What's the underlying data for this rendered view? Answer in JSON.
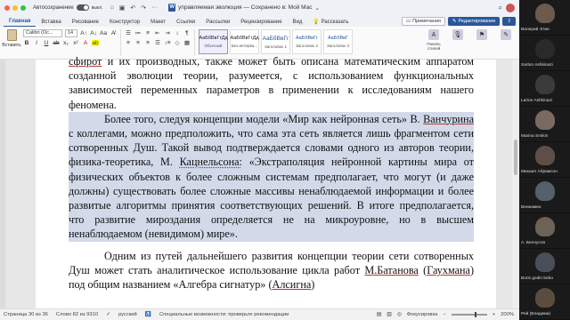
{
  "titlebar": {
    "autosave_label": "Автосохранение",
    "autosave_state": "выкл.",
    "doc_title": "управляемая эволюция — Сохранено в: Мой Мас"
  },
  "ribbon_tabs": [
    "Главная",
    "Вставка",
    "Рисование",
    "Конструктор",
    "Макет",
    "Ссылки",
    "Рассылки",
    "Рецензирование",
    "Вид",
    "Рассказать"
  ],
  "tab_buttons": {
    "comments": "Примечания",
    "edit": "Редактирование"
  },
  "ribbon": {
    "paste_label": "Вставить",
    "font_name": "Calibri (Ос...",
    "font_size": "14",
    "styles": [
      {
        "sample": "АаБбВвГгДд",
        "name": "Обычный"
      },
      {
        "sample": "АаБбВвГгДд",
        "name": "Без интерва..."
      },
      {
        "sample": "АаБбВвГг",
        "name": "Заголовок 1"
      },
      {
        "sample": "АаБбВвГг",
        "name": "Заголовок 2"
      },
      {
        "sample": "АаБбВвГ",
        "name": "Заголовок 3"
      }
    ],
    "right_buttons": [
      {
        "label": "Панель стилей",
        "icon": "styles-pane-icon"
      },
      {
        "label": "Диктовать",
        "icon": "dictate-icon"
      },
      {
        "label": "Конфиденц.",
        "icon": "sensitivity-icon"
      },
      {
        "label": "Редактор",
        "icon": "editor-icon"
      }
    ]
  },
  "document": {
    "para1": {
      "u1": "сфирот",
      "t1": " и их производных, также может быть описана математическим аппаратом созданной эволюции теории, разумеется, с использованием функциональных зависимостей переменных параметров в применении к исследованиям нашего феномена."
    },
    "para2": {
      "t1": "Более того, следуя концепции модели «Мир как нейронная сеть» В. ",
      "u1": "Ванчурина",
      "t2": " с коллегами, можно предположить, что сама эта сеть является лишь фрагментом сети сотворенных Душ. Такой вывод подтверждается словами одного из авторов теории, физика-теоретика, М. ",
      "u2": "Кацнельсона:",
      "t3": " «Экстраполяция нейронной картины мира от физических объектов к более сложным системам предполагает, что могут (и даже должны) существовать более сложные массивы ненаблюдаемой информации и более развитые алгоритмы принятия соответствующих решений. В итоге предполагается, что развитие мироздания определяется не на микроуровне, но в высшем ненаблюдаемом (невидимом) мире»."
    },
    "para3": {
      "t1": "Одним из путей дальнейшего развития концепции теории сети сотворенных Душ может стать аналитическое использование цикла работ ",
      "u1": "М.Батанова",
      "t2": " (",
      "u2": "Гаухмана",
      "t3": ") под общим названием «Алгебра сигнатур» (",
      "u3": "Алсигна",
      "t4": ")"
    }
  },
  "status": {
    "page": "Страница 30 из 36",
    "words": "Слово 82 из 9310",
    "language": "русский",
    "accessibility": "Специальные возможности: проверьте рекомендации",
    "focus": "Фокусировка",
    "zoom": "200%",
    "zoom_fraction": 0.65
  },
  "participants": [
    {
      "name": "Валерий Этин",
      "color": "#6b5a4e"
    },
    {
      "name": "Sarton Ashkinazi",
      "color": "#2a2a2a"
    },
    {
      "name": "Larion Ashkinazi",
      "color": "#3b3b3b"
    },
    {
      "name": "Marina Smikin",
      "color": "#7a6a62"
    },
    {
      "name": "Михаил Абрамсон",
      "color": "#5d4f48"
    },
    {
      "name": "Вениамин",
      "color": "#55606a"
    },
    {
      "name": "А. Белоусов",
      "color": "#6c6256"
    },
    {
      "name": "Boris godin bebo",
      "color": "#4a4e58"
    },
    {
      "name": "Рей (Владими)",
      "color": "#5b4c40"
    }
  ],
  "colors": {
    "accent": "#2b579a",
    "highlight": "#d2daea",
    "sidebar": "#111111"
  }
}
